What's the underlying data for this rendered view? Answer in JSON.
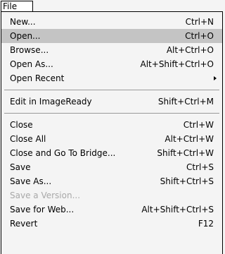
{
  "menu_title": "File",
  "groups": [
    [
      {
        "label": "New...",
        "shortcut": "Ctrl+N"
      },
      {
        "label": "Open...",
        "shortcut": "Ctrl+O",
        "highlighted": true
      },
      {
        "label": "Browse...",
        "shortcut": "Alt+Ctrl+O"
      },
      {
        "label": "Open As...",
        "shortcut": "Alt+Shift+Ctrl+O"
      },
      {
        "label": "Open Recent",
        "shortcut": "",
        "submenu": true
      }
    ],
    [
      {
        "label": "Edit in ImageReady",
        "shortcut": "Shift+Ctrl+M"
      }
    ],
    [
      {
        "label": "Close",
        "shortcut": "Ctrl+W"
      },
      {
        "label": "Close All",
        "shortcut": "Alt+Ctrl+W"
      },
      {
        "label": "Close and Go To Bridge...",
        "shortcut": "Shift+Ctrl+W"
      },
      {
        "label": "Save",
        "shortcut": "Ctrl+S"
      },
      {
        "label": "Save As...",
        "shortcut": "Shift+Ctrl+S"
      },
      {
        "label": "Save a Version...",
        "shortcut": "",
        "disabled": true
      },
      {
        "label": "Save for Web...",
        "shortcut": "Alt+Shift+Ctrl+S"
      },
      {
        "label": "Revert",
        "shortcut": "F12"
      }
    ]
  ],
  "colors": {
    "highlight": "#c4c4c4",
    "disabled_text": "#a8a8a8",
    "menu_background": "#f4f4f4"
  }
}
